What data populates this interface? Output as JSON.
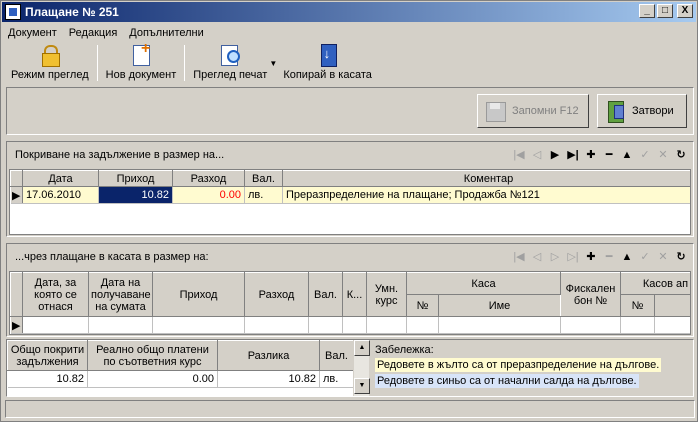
{
  "window": {
    "title": "Плащане № 251",
    "controls": {
      "minimize": "_",
      "maximize": "□",
      "close": "X"
    }
  },
  "menu": [
    "Документ",
    "Редакция",
    "Допълнителни"
  ],
  "toolbar": {
    "view_mode": "Режим преглед",
    "new_document": "Нов документ",
    "print_preview": "Преглед печат",
    "copy_to_cash": "Копирай в касата"
  },
  "actions": {
    "save": "Запомни  F12",
    "close": "Затвори"
  },
  "debt_section": {
    "title": "Покриване на задължение в размер на...",
    "columns": [
      "Дата",
      "Приход",
      "Разход",
      "Вал.",
      "Коментар"
    ],
    "rows": [
      {
        "date": "17.06.2010",
        "income": "10.82",
        "expense": "0.00",
        "currency": "лв.",
        "comment": "Преразпределение на плащане; Продажба №121"
      }
    ]
  },
  "cash_section": {
    "title": "...чрез плащане в касата в размер на:",
    "columns": {
      "date_for": "Дата, за която се отнася",
      "date_received": "Дата на получаване на сумата",
      "income": "Приход",
      "expense": "Разход",
      "currency": "Вал.",
      "k": "К...",
      "rate": "Умн. курс",
      "cash": "Каса",
      "cash_no": "№",
      "cash_name": "Име",
      "fiscal": "Фискален бон №",
      "cash_op": "Касов ап",
      "cash_op_no": "№"
    }
  },
  "totals": {
    "columns": [
      "Общо покрити задължения",
      "Реално общо платени по съответния курс",
      "Разлика",
      "Вал."
    ],
    "row": {
      "covered": "10.82",
      "paid": "0.00",
      "difference": "10.82",
      "currency": "лв."
    }
  },
  "notes": {
    "label": "Забележка:",
    "yellow": "Редовете в жълто са от преразпределение на дългове.",
    "blue": "Редовете в синьо са от начални салда на дългове."
  },
  "nav_icons": [
    "first-icon",
    "prev-icon",
    "next-icon",
    "last-icon",
    "add-icon",
    "delete-icon",
    "up-icon",
    "confirm-icon",
    "cancel-icon",
    "refresh-icon"
  ]
}
